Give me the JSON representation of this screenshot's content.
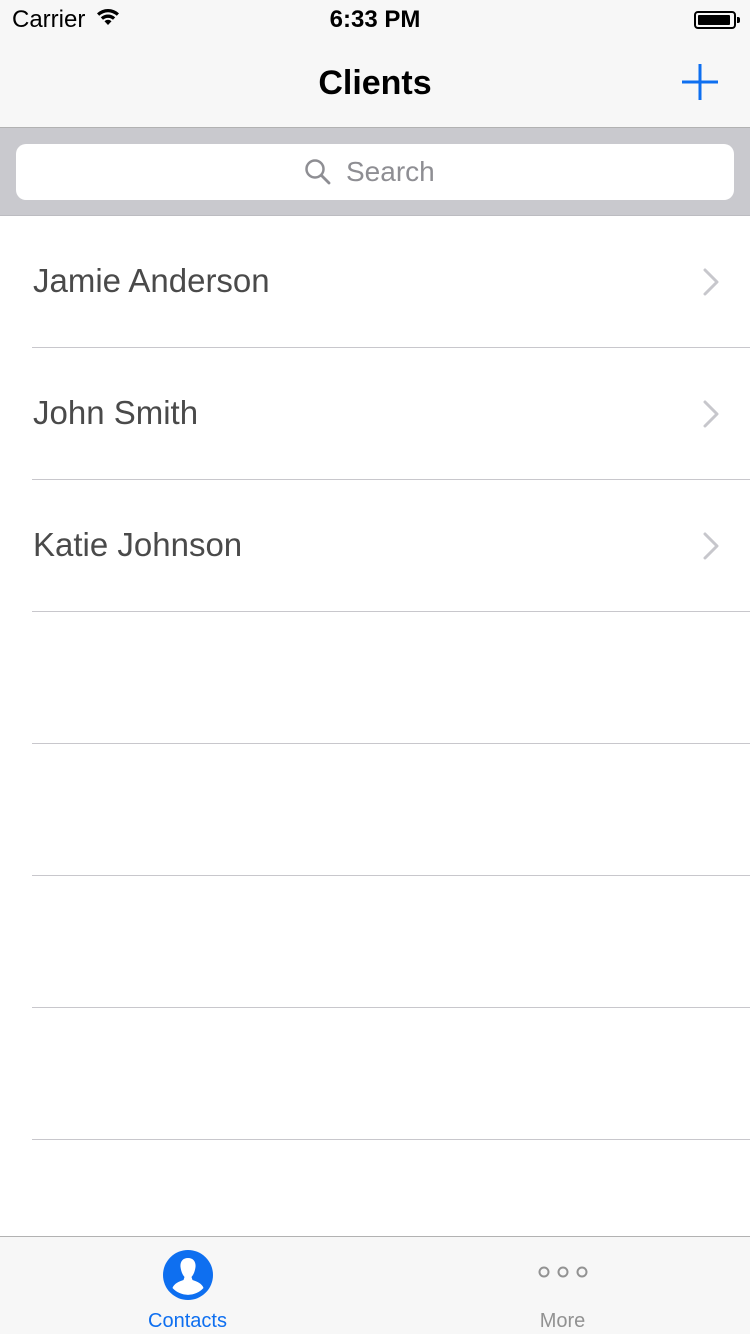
{
  "status_bar": {
    "carrier": "Carrier",
    "time": "6:33 PM"
  },
  "nav": {
    "title": "Clients",
    "add_icon": "plus-icon"
  },
  "search": {
    "placeholder": "Search",
    "value": ""
  },
  "clients": [
    {
      "name": "Jamie Anderson"
    },
    {
      "name": "John Smith"
    },
    {
      "name": "Katie Johnson"
    }
  ],
  "tabs": [
    {
      "label": "Contacts",
      "icon": "contacts-icon",
      "selected": true
    },
    {
      "label": "More",
      "icon": "more-icon",
      "selected": false
    }
  ],
  "colors": {
    "accent": "#0e6ff0",
    "inactive": "#929292",
    "text": "#4a4a4a"
  }
}
